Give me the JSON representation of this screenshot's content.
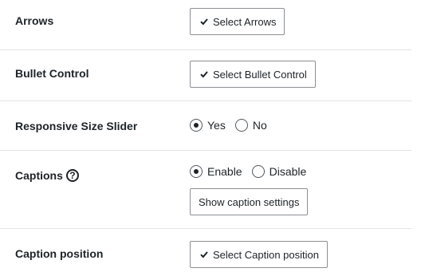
{
  "settings": {
    "arrows": {
      "label": "Arrows",
      "button_label": "Select Arrows",
      "button_icon": "checkmark-icon"
    },
    "bullet_control": {
      "label": "Bullet Control",
      "button_label": "Select Bullet Control",
      "button_icon": "checkmark-icon"
    },
    "responsive_size_slider": {
      "label": "Responsive Size Slider",
      "options": [
        {
          "label": "Yes",
          "checked": true
        },
        {
          "label": "No",
          "checked": false
        }
      ]
    },
    "captions": {
      "label": "Captions",
      "help_icon": "question-circle-icon",
      "help_glyph": "?",
      "options": [
        {
          "label": "Enable",
          "checked": true
        },
        {
          "label": "Disable",
          "checked": false
        }
      ],
      "settings_button_label": "Show caption settings"
    },
    "caption_position": {
      "label": "Caption position",
      "button_label": "Select Caption position",
      "button_icon": "checkmark-icon"
    }
  }
}
